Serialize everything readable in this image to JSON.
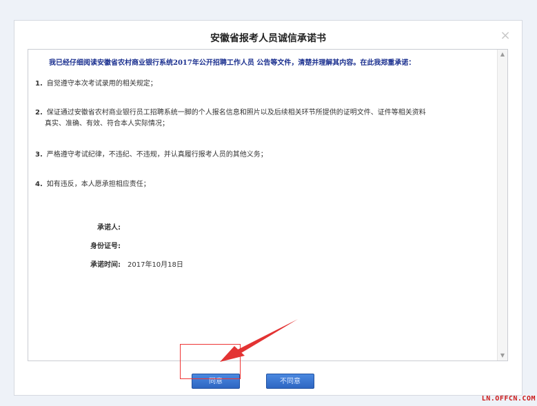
{
  "modal": {
    "title": "安徽省报考人员诚信承诺书",
    "close_glyph": "×"
  },
  "letter": {
    "intro": "我已经仔细阅读安徽省农村商业银行系统2017年公开招聘工作人员 公告等文件，清楚并理解其内容。在此我郑重承诺：",
    "clauses": [
      {
        "num": "1.",
        "text": "自觉遵守本次考试录用的相关规定；",
        "cont": ""
      },
      {
        "num": "2.",
        "text": "保证通过安徽省农村商业银行员工招聘系统一脚的个人报名信息和照片以及后续相关环节所提供的证明文件、证件等相关资料",
        "cont": "真实、准确、有效、符合本人实际情况；"
      },
      {
        "num": "3.",
        "text": "严格遵守考试纪律，不违纪、不违规，并认真履行报考人员的其他义务；",
        "cont": ""
      },
      {
        "num": "4.",
        "text": "如有违反，本人愿承担相应责任；",
        "cont": ""
      }
    ],
    "signature": {
      "promisor_label": "承诺人:",
      "promisor_value": "",
      "id_label": "身份证号:",
      "id_value": "",
      "time_label": "承诺时间:",
      "time_value": "2017年10月18日"
    }
  },
  "buttons": {
    "agree": "同意",
    "disagree": "不同意"
  },
  "watermark": "LN.OFFCN.COM",
  "colors": {
    "intro_text": "#1a2f8f",
    "button": "#3a74d2",
    "annotation": "#e33333"
  }
}
